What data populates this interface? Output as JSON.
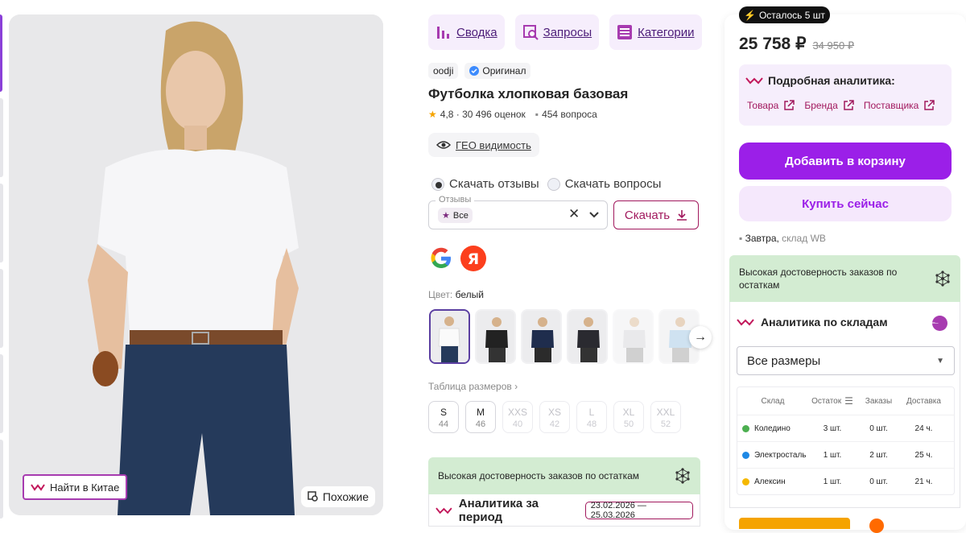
{
  "nav": {
    "summary": "Сводка",
    "queries": "Запросы",
    "categories": "Категории"
  },
  "product": {
    "brand": "oodji",
    "original": "Оригинал",
    "title": "Футболка хлопковая базовая",
    "rating": "4,8 · 30 496 оценок",
    "questions": "454 вопроса",
    "geo": "ГЕО видимость"
  },
  "photo": {
    "china_button": "Найти в Китае",
    "similar_button": "Похожие"
  },
  "download": {
    "reviews_radio": "Скачать отзывы",
    "questions_radio": "Скачать вопросы",
    "field_legend": "Отзывы",
    "tag": "Все",
    "button": "Скачать"
  },
  "color": {
    "label": "Цвет:",
    "value": "белый"
  },
  "size_table_link": "Таблица размеров",
  "sizes": [
    {
      "label": "S",
      "num": "44"
    },
    {
      "label": "M",
      "num": "46"
    },
    {
      "label": "XXS",
      "num": "40"
    },
    {
      "label": "XS",
      "num": "42"
    },
    {
      "label": "L",
      "num": "48"
    },
    {
      "label": "XL",
      "num": "50"
    },
    {
      "label": "XXL",
      "num": "52"
    }
  ],
  "confidence": "Высокая достоверность заказов по остаткам",
  "period": {
    "title": "Аналитика за период",
    "dates": "23.02.2026 — 25.03.2026"
  },
  "sidebar": {
    "stock_badge": "Осталось 5 шт",
    "price": "25 758 ₽",
    "old_price": "34 950 ₽",
    "analytics_title": "Подробная аналитика:",
    "links": [
      "Товара",
      "Бренда",
      "Поставщика"
    ],
    "cart": "Добавить в корзину",
    "buy": "Купить сейчас",
    "delivery_day": "Завтра,",
    "delivery_place": "склад WB",
    "confidence": "Высокая достоверность заказов по остаткам",
    "warehouse_title": "Аналитика по складам",
    "size_select": "Все размеры"
  },
  "warehouse_table": {
    "headers": [
      "Склад",
      "Остаток",
      "Заказы",
      "Доставка"
    ],
    "rows": [
      {
        "name": "Коледино",
        "stock": "3 шт.",
        "orders": "0 шт.",
        "delivery": "24 ч.",
        "color": "#4caf50"
      },
      {
        "name": "Электросталь",
        "stock": "1 шт.",
        "orders": "2 шт.",
        "delivery": "25 ч.",
        "color": "#1e88e5"
      },
      {
        "name": "Алексин",
        "stock": "1 шт.",
        "orders": "0 шт.",
        "delivery": "21 ч.",
        "color": "#f5b800"
      }
    ]
  },
  "colors": {
    "accent": "#9b1fe8",
    "magenta": "#a1185d",
    "green_bg": "#d3ecd2"
  }
}
